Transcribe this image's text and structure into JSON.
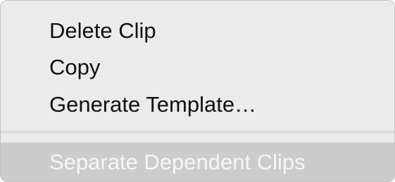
{
  "context_menu": {
    "items": [
      {
        "label": "Delete Clip",
        "enabled": true,
        "highlighted": false
      },
      {
        "label": "Copy",
        "enabled": true,
        "highlighted": false
      },
      {
        "label": "Generate Template…",
        "enabled": true,
        "highlighted": false
      },
      {
        "label": "Separate Dependent Clips",
        "enabled": false,
        "highlighted": true
      }
    ]
  }
}
